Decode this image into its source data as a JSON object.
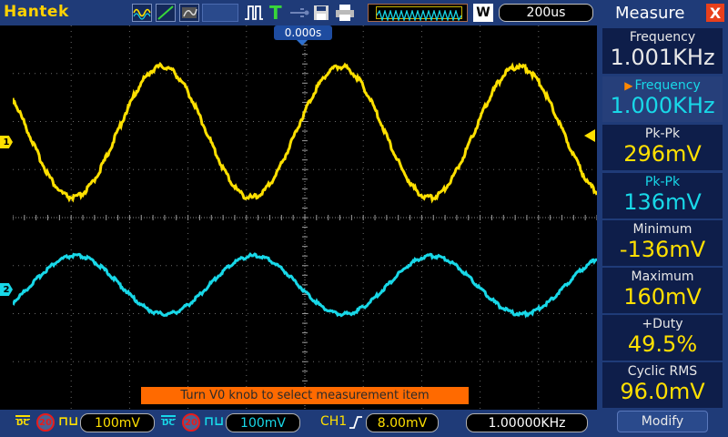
{
  "header": {
    "brand": "Hantek",
    "trigger_status": "T",
    "run_mode": "W",
    "timebase": "200us",
    "trigger_position": "0.000s"
  },
  "channels": {
    "ch1": {
      "marker": "1",
      "color": "#ffe000",
      "coupling": "DC",
      "bandwidth_limit": "20",
      "scale": "100mV"
    },
    "ch2": {
      "marker": "2",
      "color": "#18d8e8",
      "coupling": "DC",
      "bandwidth_limit": "20",
      "scale": "100mV"
    }
  },
  "trigger": {
    "source": "CH1",
    "edge": "rising-edge-icon",
    "level": "8.00mV",
    "frequency": "1.00000KHz"
  },
  "hint": "Turn V0 knob to select measurement item",
  "measure_panel": {
    "title": "Measure",
    "close_label": "X",
    "modify_label": "Modify",
    "items": [
      {
        "label": "Frequency",
        "value": "1.001KHz",
        "channel": "ch1"
      },
      {
        "label": "Frequency",
        "value": "1.000KHz",
        "channel": "ch2"
      },
      {
        "label": "Pk-Pk",
        "value": "296mV",
        "channel": "ch1"
      },
      {
        "label": "Pk-Pk",
        "value": "136mV",
        "channel": "ch2"
      },
      {
        "label": "Minimum",
        "value": "-136mV",
        "channel": "ch1"
      },
      {
        "label": "Maximum",
        "value": "160mV",
        "channel": "ch1"
      },
      {
        "label": "+Duty",
        "value": "49.5%",
        "channel": "ch1"
      },
      {
        "label": "Cyclic RMS",
        "value": "96.0mV",
        "channel": "ch1"
      }
    ]
  },
  "colors": {
    "panel_blue": "#1f3b78",
    "ch1": "#ffe000",
    "ch2": "#18d8e8",
    "hint_bg": "#ff6a00",
    "close_btn": "#e8401c"
  }
}
